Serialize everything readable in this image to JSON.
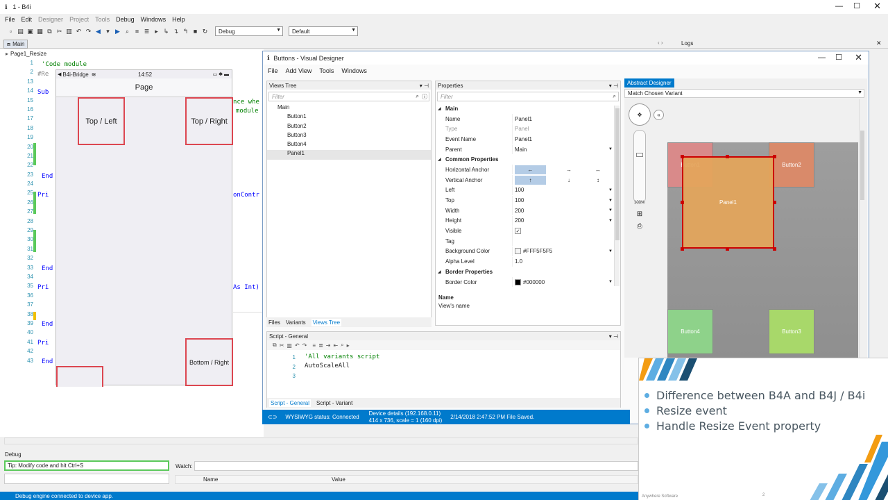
{
  "titlebar": {
    "title": "1 - B4i"
  },
  "menu": [
    "File",
    "Edit",
    "Designer",
    "Project",
    "Tools",
    "Debug",
    "Windows",
    "Help"
  ],
  "toolbar": {
    "config_value": "Debug",
    "target_value": "Default"
  },
  "strip": {
    "main_tab": "Main",
    "logs_label": "Logs"
  },
  "editor": {
    "tab": "Page1_Resize"
  },
  "code": {
    "line_numbers": [
      "1",
      "2",
      "13",
      "14",
      "15",
      "16",
      "17",
      "18",
      "19",
      "20",
      "21",
      "22",
      "23",
      "24",
      "25",
      "26",
      "27",
      "28",
      "29",
      "30",
      "31",
      "32",
      "33",
      "34",
      "35",
      "36",
      "37",
      "38",
      "39",
      "40",
      "41",
      "42",
      "43"
    ],
    "l1": "'Code module",
    "l2": "#Re",
    "l13": "Sub",
    "l14": "nce whe",
    "l15": "module",
    "l22": "End",
    "l23": "Pri",
    "l24": "onContr",
    "l31": "End",
    "l33": "Pri",
    "l34": "As Int)",
    "l37": "End",
    "l39": "Pri",
    "l41": "End"
  },
  "phone": {
    "carrier": "B4i-Bridge",
    "time": "14:52",
    "nav_title": "Page",
    "top_left": "Top / Left",
    "top_right": "Top / Right",
    "bottom_right": "Bottom / Right"
  },
  "designer": {
    "title": "Buttons - Visual Designer",
    "menu": [
      "File",
      "Add View",
      "Tools",
      "Windows"
    ],
    "views_tree": {
      "header": "Views Tree",
      "filter": "Filter",
      "items": [
        "Main",
        "Button1",
        "Button2",
        "Button3",
        "Button4",
        "Panel1"
      ],
      "tabs": [
        "Files",
        "Variants",
        "Views Tree"
      ]
    },
    "properties": {
      "header": "Properties",
      "filter": "Filter",
      "rows": [
        {
          "cat": "Main"
        },
        {
          "name": "Name",
          "value": "Panel1"
        },
        {
          "name": "Type",
          "value": "Panel",
          "muted": true
        },
        {
          "name": "Event Name",
          "value": "Panel1"
        },
        {
          "name": "Parent",
          "value": "Main",
          "dd": true
        },
        {
          "cat": "Common Properties"
        },
        {
          "name": "Horizontal Anchor",
          "anchor": "h"
        },
        {
          "name": "Vertical Anchor",
          "anchor": "v"
        },
        {
          "name": "Left",
          "value": "100",
          "dd": true
        },
        {
          "name": "Top",
          "value": "100",
          "dd": true
        },
        {
          "name": "Width",
          "value": "200",
          "dd": true
        },
        {
          "name": "Height",
          "value": "200",
          "dd": true
        },
        {
          "name": "Visible",
          "check": true
        },
        {
          "name": "Tag",
          "value": ""
        },
        {
          "name": "Background Color",
          "value": "#FFF5F5F5",
          "swatch": "#f5f5f5",
          "dd": true
        },
        {
          "name": "Alpha Level",
          "value": "1.0"
        },
        {
          "cat": "Border Properties"
        },
        {
          "name": "Border Color",
          "value": "#000000",
          "swatch": "#000000",
          "dd": true
        }
      ],
      "desc_title": "Name",
      "desc_text": "View's name"
    },
    "script": {
      "header": "Script - General",
      "line1": "'All variants script",
      "line2": "AutoScaleAll",
      "nums": [
        "1",
        "2",
        "3"
      ],
      "tabs": [
        "Script - General",
        "Script - Variant"
      ]
    },
    "abstract": {
      "tab": "Abstract Designer",
      "variant": "Match Chosen Variant",
      "zoom": "100%",
      "btn1": "Button1",
      "btn2": "Button2",
      "btn3": "Button3",
      "btn4": "Button4",
      "panel": "Panel1"
    }
  },
  "status": {
    "wysiwyg": "WYSIWYG status: Connected",
    "device1": "Device details (192.168.0.11)",
    "device2": "414 x 736, scale = 1 (160 dpi)",
    "saved": "2/14/2018 2:47:52 PM  File Saved."
  },
  "debug": {
    "label": "Debug",
    "tip": "Tip: Modify code and hit Ctrl+S",
    "watch": "Watch:",
    "col_name": "Name",
    "col_value": "Value",
    "engine": "Debug engine connected to device app."
  },
  "slide": {
    "bullets": [
      "Difference between B4A and B4J / B4i",
      "Resize event",
      "Handle Resize Event property"
    ],
    "footer": "Anywhere Software",
    "page": "2"
  },
  "colors": {
    "accent": "#007acc",
    "red": "#dc4650"
  }
}
